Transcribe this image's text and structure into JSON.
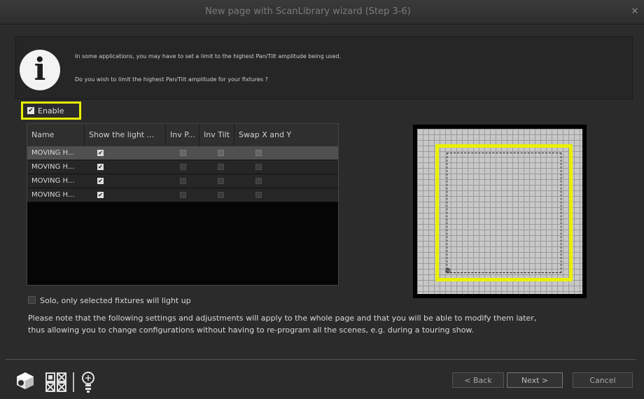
{
  "window": {
    "title": "New page with ScanLibrary wizard (Step 3-6)"
  },
  "info": {
    "line1": "In some applications, you may have to set a limit to the highest Pan/Tilt amplitude being used.",
    "line2": "Do you wish to limit the highest Pan/Tilt amplitude for your fixtures ?"
  },
  "enable": {
    "label": "Enable",
    "checked": true
  },
  "table": {
    "columns": [
      "Name",
      "Show the light ...",
      "Inv P...",
      "Inv Tilt",
      "Swap X and Y"
    ],
    "rows": [
      {
        "name": "MOVING H...",
        "show": true,
        "inv_pan": false,
        "inv_tilt": false,
        "swap": false,
        "selected": true
      },
      {
        "name": "MOVING H...",
        "show": true,
        "inv_pan": false,
        "inv_tilt": false,
        "swap": false,
        "selected": false
      },
      {
        "name": "MOVING H...",
        "show": true,
        "inv_pan": false,
        "inv_tilt": false,
        "swap": false,
        "selected": false
      },
      {
        "name": "MOVING H...",
        "show": true,
        "inv_pan": false,
        "inv_tilt": false,
        "swap": false,
        "selected": false
      }
    ]
  },
  "solo": {
    "label": "Solo, only selected fixtures will light up",
    "checked": false
  },
  "note": {
    "line1": "Please note that the following settings and adjustments will apply to the whole page and that you will be able to modify them later,",
    "line2": "thus allowing you to change configurations without having to re-program all the scenes, e.g. during a touring show."
  },
  "buttons": {
    "back": "< Back",
    "next": "Next >",
    "cancel": "Cancel"
  },
  "colors": {
    "highlight": "#e8f000",
    "background": "#2b2b2b"
  }
}
